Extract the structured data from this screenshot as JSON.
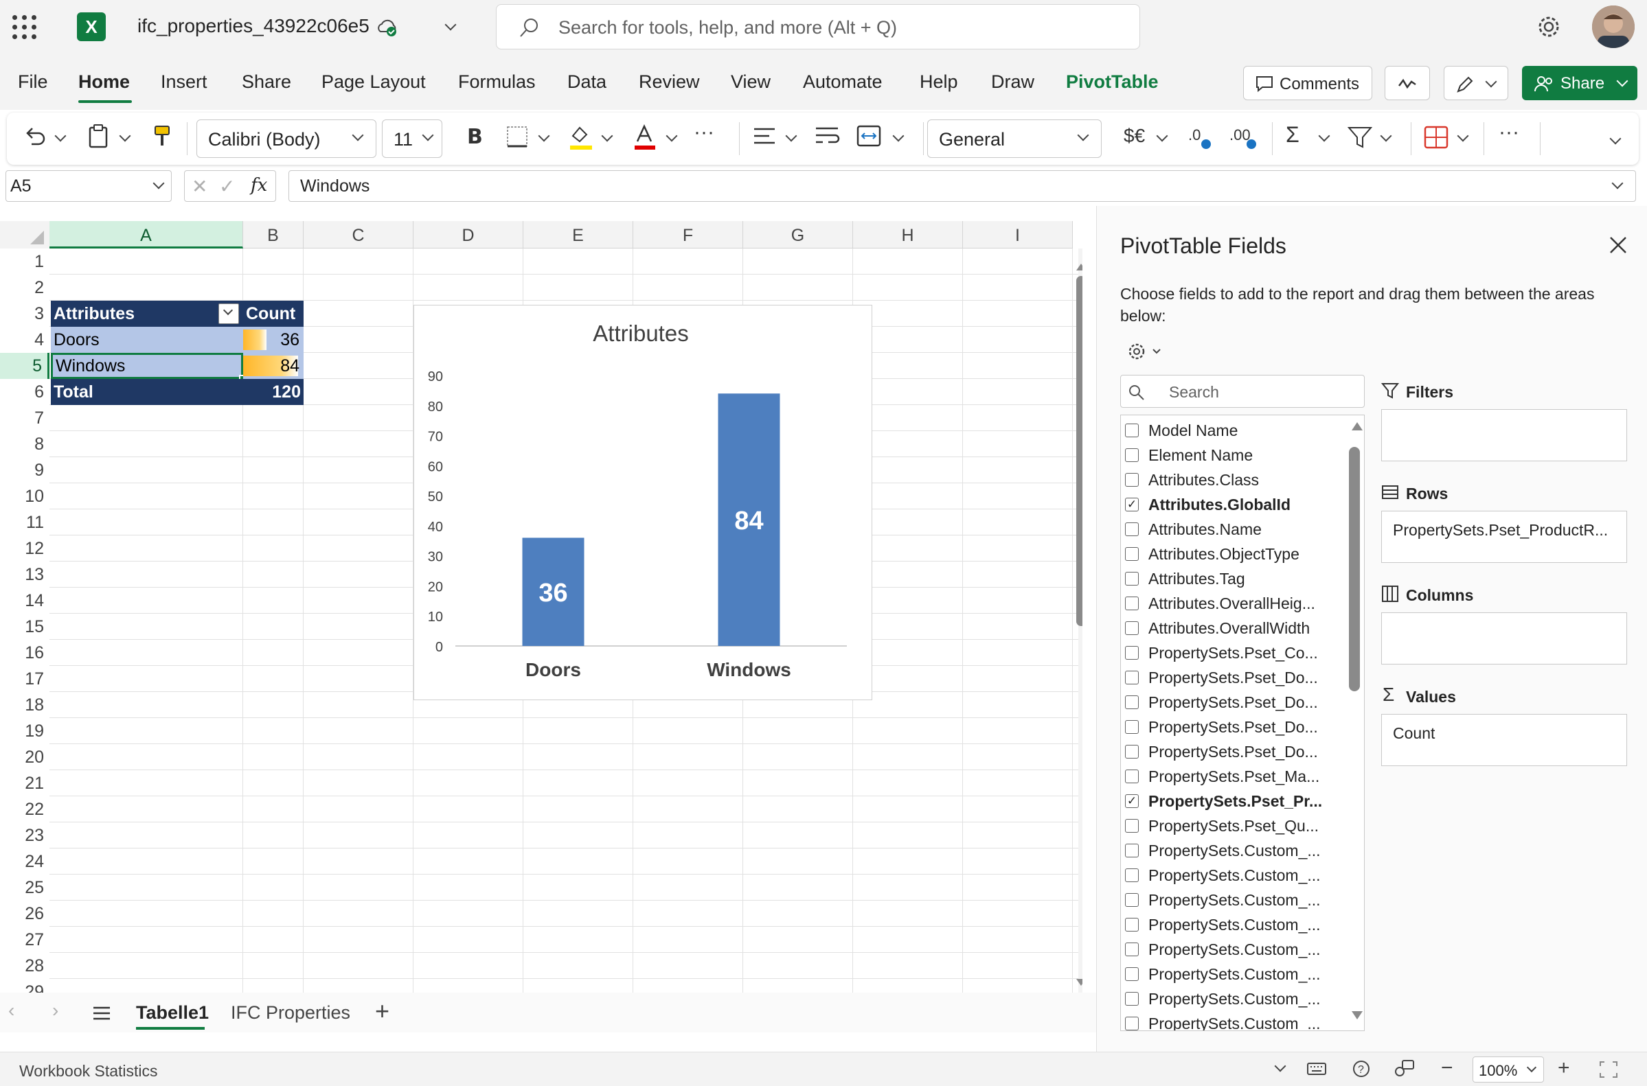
{
  "titlebar": {
    "doc_title": "ifc_properties_43922c06e5",
    "search_placeholder": "Search for tools, help, and more (Alt + Q)"
  },
  "menu": {
    "tabs": [
      "File",
      "Home",
      "Insert",
      "Share",
      "Page Layout",
      "Formulas",
      "Data",
      "Review",
      "View",
      "Automate",
      "Help",
      "Draw",
      "PivotTable"
    ],
    "comments_label": "Comments",
    "share_label": "Share"
  },
  "ribbon": {
    "font_name": "Calibri (Body)",
    "font_size": "11",
    "number_format": "General",
    "currency_label": "$€"
  },
  "formula_bar": {
    "name_box": "A5",
    "content": "Windows"
  },
  "grid": {
    "columns": [
      "A",
      "B",
      "C",
      "D",
      "E",
      "F",
      "G",
      "H",
      "I"
    ],
    "rows": [
      "1",
      "2",
      "3",
      "4",
      "5",
      "6",
      "7",
      "8",
      "9",
      "10",
      "11",
      "12",
      "13",
      "14",
      "15",
      "16",
      "17",
      "18",
      "19",
      "20",
      "21",
      "22",
      "23",
      "24",
      "25",
      "26",
      "27",
      "28",
      "29"
    ],
    "selected_col": "A",
    "selected_row": "5"
  },
  "pivot_table": {
    "header_label": "Attributes",
    "header_value": "Count",
    "rows": [
      {
        "label": "Doors",
        "value": "36"
      },
      {
        "label": "Windows",
        "value": "84"
      }
    ],
    "total_label": "Total",
    "total_value": "120"
  },
  "chart_data": {
    "type": "bar",
    "title": "Attributes",
    "categories": [
      "Doors",
      "Windows"
    ],
    "values": [
      36,
      84
    ],
    "data_labels": [
      "36",
      "84"
    ],
    "ylim": [
      0,
      90
    ],
    "yticks": [
      "0",
      "10",
      "20",
      "30",
      "40",
      "50",
      "60",
      "70",
      "80",
      "90"
    ],
    "color": "#4e7fbf",
    "grid": false,
    "legend": "none"
  },
  "panel": {
    "title": "PivotTable Fields",
    "description": "Choose fields to add to the report and drag them between the areas below:",
    "search_placeholder": "Search",
    "fields": [
      {
        "label": "Model Name",
        "checked": false
      },
      {
        "label": "Element Name",
        "checked": false
      },
      {
        "label": "Attributes.Class",
        "checked": false
      },
      {
        "label": "Attributes.GlobalId",
        "checked": true
      },
      {
        "label": "Attributes.Name",
        "checked": false
      },
      {
        "label": "Attributes.ObjectType",
        "checked": false
      },
      {
        "label": "Attributes.Tag",
        "checked": false
      },
      {
        "label": "Attributes.OverallHeig...",
        "checked": false
      },
      {
        "label": "Attributes.OverallWidth",
        "checked": false
      },
      {
        "label": "PropertySets.Pset_Co...",
        "checked": false
      },
      {
        "label": "PropertySets.Pset_Do...",
        "checked": false
      },
      {
        "label": "PropertySets.Pset_Do...",
        "checked": false
      },
      {
        "label": "PropertySets.Pset_Do...",
        "checked": false
      },
      {
        "label": "PropertySets.Pset_Do...",
        "checked": false
      },
      {
        "label": "PropertySets.Pset_Ma...",
        "checked": false
      },
      {
        "label": "PropertySets.Pset_Pr...",
        "checked": true
      },
      {
        "label": "PropertySets.Pset_Qu...",
        "checked": false
      },
      {
        "label": "PropertySets.Custom_...",
        "checked": false
      },
      {
        "label": "PropertySets.Custom_...",
        "checked": false
      },
      {
        "label": "PropertySets.Custom_...",
        "checked": false
      },
      {
        "label": "PropertySets.Custom_...",
        "checked": false
      },
      {
        "label": "PropertySets.Custom_...",
        "checked": false
      },
      {
        "label": "PropertySets.Custom_...",
        "checked": false
      },
      {
        "label": "PropertySets.Custom_...",
        "checked": false
      },
      {
        "label": "PropertySets.Custom_...",
        "checked": false
      }
    ],
    "areas": {
      "filters_label": "Filters",
      "filters_value": "",
      "rows_label": "Rows",
      "rows_value": "PropertySets.Pset_ProductR...",
      "columns_label": "Columns",
      "columns_value": "",
      "values_label": "Values",
      "values_value": "Count"
    }
  },
  "sheets": {
    "tabs": [
      "Tabelle1",
      "IFC Properties"
    ],
    "active": "Tabelle1"
  },
  "status": {
    "left_label": "Workbook Statistics",
    "zoom": "100%"
  },
  "colors": {
    "accent": "#107c41",
    "pivot_header": "#1f3864",
    "pivot_row": "#b4c6e7"
  }
}
